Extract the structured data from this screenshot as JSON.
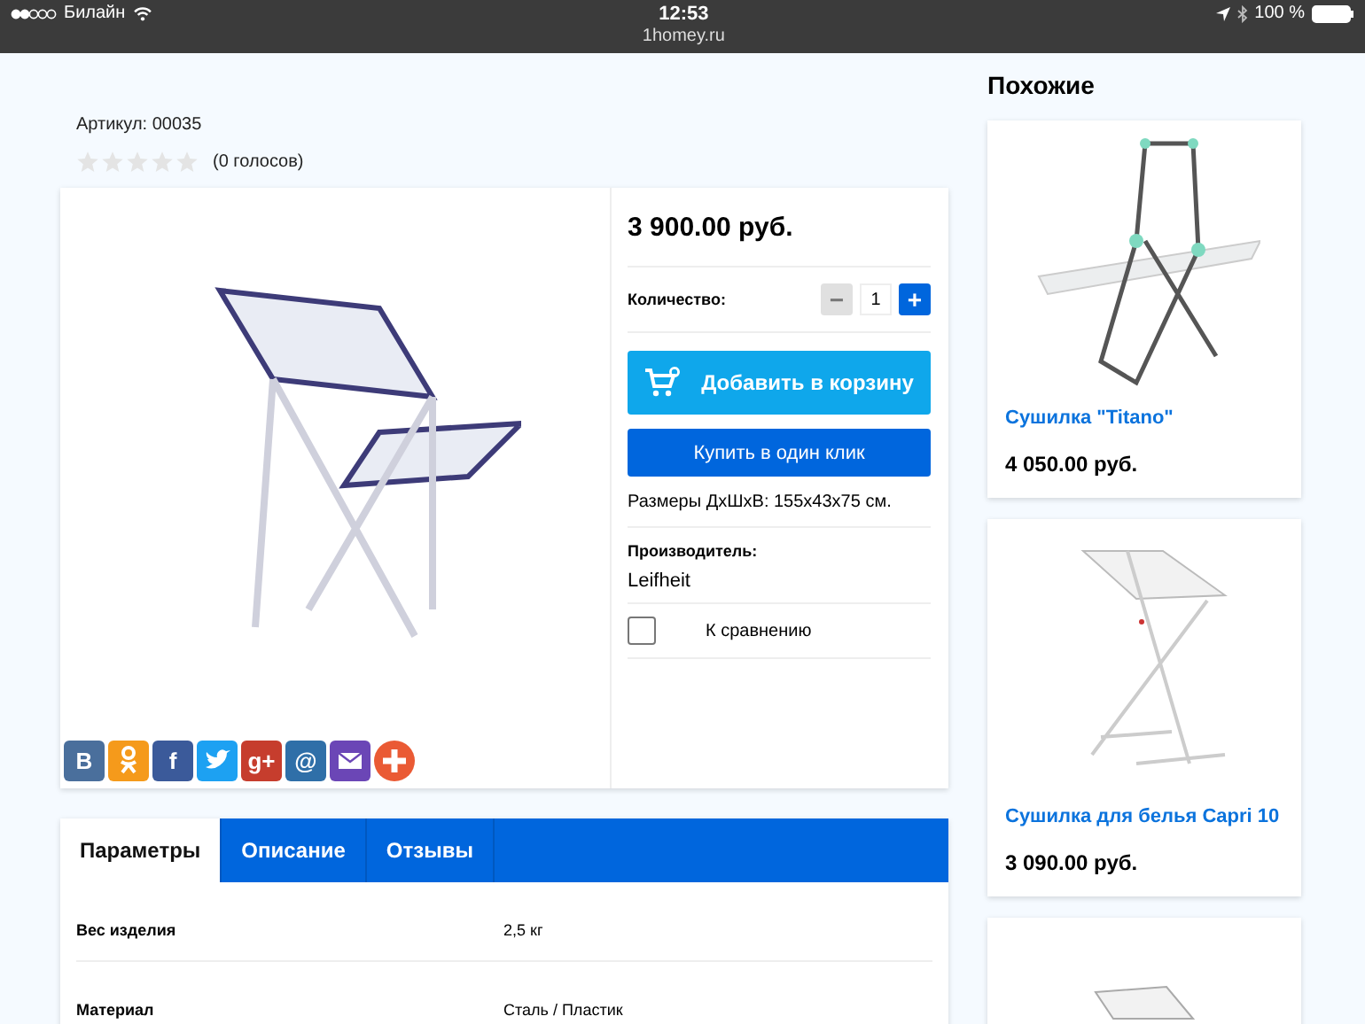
{
  "status_bar": {
    "carrier": "Билайн",
    "time": "12:53",
    "url": "1homey.ru",
    "battery": "100 %"
  },
  "product": {
    "sku": "Артикул: 00035",
    "stars": 0,
    "votes": "(0 голосов)",
    "price": "3 900.00 руб.",
    "quantity_label": "Количество:",
    "quantity": "1",
    "minus": "−",
    "plus": "+",
    "add_to_cart": "Добавить в корзину",
    "buy_one_click": "Купить в один клик",
    "dimensions": "Размеры ДхШхВ: 155x43x75 см.",
    "manufacturer_label": "Производитель:",
    "manufacturer": "Leifheit",
    "compare": {
      "label": "К сравнению",
      "checked": false
    }
  },
  "share_buttons": [
    {
      "kind": "letter",
      "label": "В",
      "color": "#4a6f9c"
    },
    {
      "kind": "ok",
      "color": "#f59a1b"
    },
    {
      "kind": "letter",
      "label": "f",
      "color": "#3b5a9a"
    },
    {
      "kind": "twitter",
      "color": "#1da1f2"
    },
    {
      "kind": "letter",
      "label": "g+",
      "color": "#c63d2d"
    },
    {
      "kind": "letter",
      "label": "@",
      "color": "#2f6fa8"
    },
    {
      "kind": "mail",
      "color": "#6b46b6"
    },
    {
      "kind": "plus",
      "color": "#ea5a34"
    }
  ],
  "tabs": [
    {
      "label": "Параметры",
      "selected": true
    },
    {
      "label": "Описание",
      "selected": false
    },
    {
      "label": "Отзывы",
      "selected": false
    }
  ],
  "params": [
    {
      "name": "Вес изделия",
      "value": "2,5 кг"
    },
    {
      "name": "Материал",
      "value": "Сталь / Пластик"
    }
  ],
  "similar": {
    "title": "Похожие",
    "items": [
      {
        "kind": "titano",
        "name": "Сушилка \"Titano\"",
        "price": "4 050.00 руб."
      },
      {
        "kind": "capri",
        "name": "Сушилка для белья Capri 10",
        "price": "3 090.00 руб."
      },
      {
        "kind": "partial"
      }
    ]
  }
}
